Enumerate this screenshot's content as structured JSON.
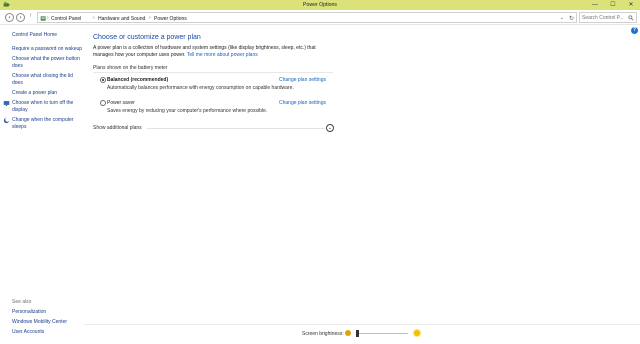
{
  "window": {
    "title": "Power Options",
    "minimize": "—",
    "maximize": "☐",
    "close": "✕"
  },
  "address": {
    "back": "‹",
    "forward": "›",
    "up": "↑",
    "crumbs": [
      "Control Panel",
      "Hardware and Sound",
      "Power Options"
    ],
    "separator": "›",
    "dropdown": "⌄",
    "refresh": "↻",
    "search_placeholder": "Search Control P...",
    "search_icon": "search-icon"
  },
  "help": "?",
  "sidebar": {
    "home": "Control Panel Home",
    "items": [
      {
        "lines": [
          "Require a password on wakeup"
        ]
      },
      {
        "lines": [
          "Choose what the power button",
          "does"
        ]
      },
      {
        "lines": [
          "Choose what closing the lid",
          "does"
        ]
      },
      {
        "lines": [
          "Create a power plan"
        ]
      },
      {
        "lines": [
          "Choose when to turn off the",
          "display"
        ],
        "icon": "display-icon"
      },
      {
        "lines": [
          "Change when the computer",
          "sleeps"
        ],
        "icon": "moon-icon"
      }
    ],
    "see_also": "See also",
    "see_also_items": [
      "Personalization",
      "Windows Mobility Center",
      "User Accounts"
    ]
  },
  "main": {
    "heading": "Choose or customize a power plan",
    "description": "A power plan is a collection of hardware and system settings (like display brightness, sleep, etc.) that manages how your computer uses power.",
    "tell_me_more": "Tell me more about power plans",
    "group_label": "Plans shown on the battery meter",
    "plans": [
      {
        "name": "Balanced (recommended)",
        "desc": "Automatically balances performance with energy consumption on capable hardware.",
        "link": "Change plan settings",
        "selected": true
      },
      {
        "name": "Power saver",
        "desc": "Saves energy by reducing your computer's performance where possible.",
        "link": "Change plan settings",
        "selected": false
      }
    ],
    "show_additional": "Show additional plans",
    "expand_glyph": "⌄"
  },
  "footer": {
    "brightness_label": "Screen brightness:",
    "brightness_level": 0.0
  },
  "colors": {
    "titlebar": "#dce27a",
    "link": "#1a5fc7",
    "heading": "#1e4aa0"
  }
}
